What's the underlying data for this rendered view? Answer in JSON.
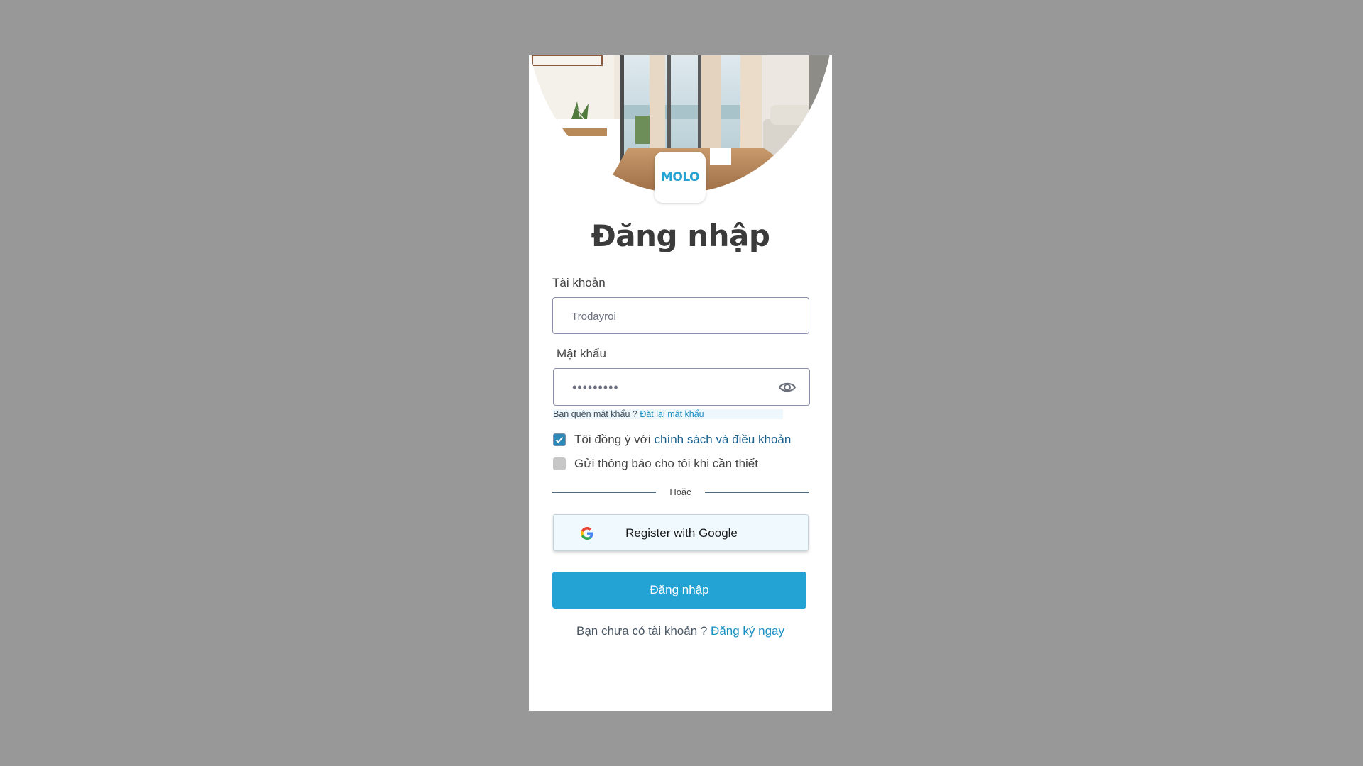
{
  "app": {
    "logo_text": "MOLO",
    "title": "Đăng nhập"
  },
  "account": {
    "label": "Tài khoản",
    "value": "Trodayroi"
  },
  "password": {
    "label": "Mật khẩu",
    "value": "•••••••••"
  },
  "forgot": {
    "text": "Bạn quên mật khẩu ? ",
    "link": "Đặt lại mật khẩu"
  },
  "agree": {
    "text": "Tôi đồng ý với",
    "link": "chính sách và điều khoản",
    "checked": true
  },
  "notify": {
    "text": "Gửi thông báo cho tôi khi cần thiết",
    "checked": false
  },
  "divider_text": "Hoặc",
  "google_button": {
    "label": "Register with Google",
    "icon": "google-icon"
  },
  "login_button": {
    "label": "Đăng nhập"
  },
  "signup": {
    "text": "Bạn chưa có tài khoản ? ",
    "link": "Đăng ký ngay"
  },
  "colors": {
    "background": "#989898",
    "primary": "#23a2d4",
    "link": "#1a8fc4",
    "title": "#3b3b3b"
  }
}
